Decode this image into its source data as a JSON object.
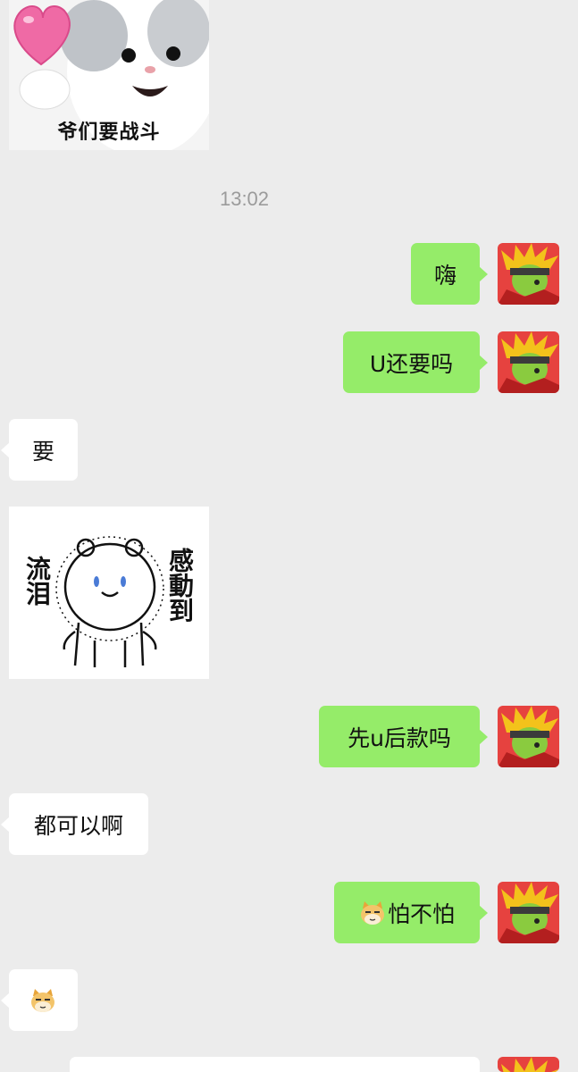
{
  "timestamp": "13:02",
  "stickers": {
    "cat_caption": "爷们要战斗",
    "bear_left": "流泪",
    "bear_right": "感動到"
  },
  "messages": {
    "m1": "嗨",
    "m2": "U还要吗",
    "m3": "要",
    "m4": "先u后款吗",
    "m5": "都可以啊",
    "m6_text": "怕不怕"
  },
  "icons": {
    "avatar": "avatar-icon",
    "doge": "doge-emoji-icon",
    "heart": "heart-icon"
  },
  "colors": {
    "background": "#ececec",
    "outgoing_bubble": "#95ec69",
    "incoming_bubble": "#ffffff",
    "timestamp": "#9b9b9b"
  }
}
